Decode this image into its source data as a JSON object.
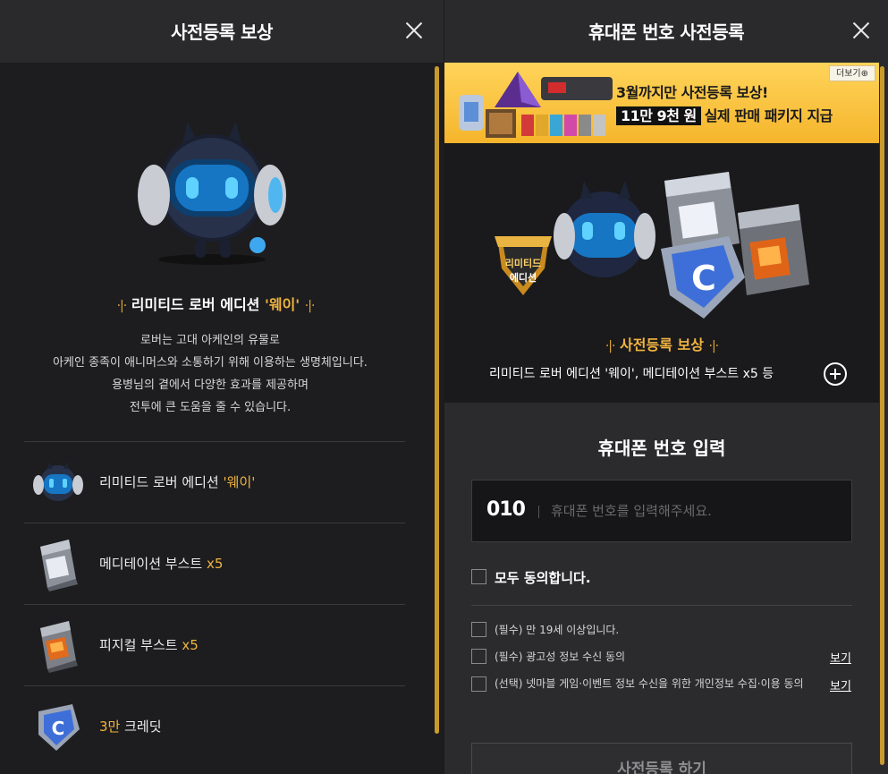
{
  "left_panel": {
    "title": "사전등록 보상",
    "reward_prefix": "리미티드 로버 에디션 ",
    "reward_highlight": "'웨이'",
    "deco": "·|·",
    "description": [
      "로버는 고대 아케인의 유물로",
      "아케인 종족이 애니머스와 소통하기 위해 이용하는 생명체입니다.",
      "용병님의 곁에서 다양한 효과를 제공하며",
      "전투에 큰 도움을 줄 수 있습니다."
    ],
    "items": [
      {
        "label": "리미티드 로버 에디션 ",
        "highlight": "'웨이'",
        "icon": "rover-icon"
      },
      {
        "label": "메디테이션 부스트 ",
        "highlight": "x5",
        "icon": "silver-box-icon"
      },
      {
        "label": "피지컬 부스트 ",
        "highlight": "x5",
        "icon": "orange-box-icon"
      },
      {
        "label": " 크레딧",
        "highlight_first": "3만",
        "icon": "credit-badge-icon"
      }
    ]
  },
  "right_panel": {
    "title": "휴대폰 번호 사전등록",
    "banner": {
      "more": "더보기⊕",
      "line1": "3월까지만 사전등록 보상!",
      "line2_highlight": "11만 9천 원",
      "line2_rest": "실제 판매 패키지 지급"
    },
    "hero": {
      "badge_line1": "리미티드",
      "badge_line2": "에디션",
      "caption_title": "사전등록 보상",
      "caption_detail": "리미티드 로버 에디션 '웨이', 메디테이션 부스트 x5 등"
    },
    "form": {
      "title": "휴대폰 번호 입력",
      "prefix": "010",
      "placeholder": "휴대폰 번호를 입력해주세요.",
      "agree_all": "모두 동의합니다.",
      "terms": [
        {
          "text": "(필수) 만 19세 이상입니다.",
          "view": ""
        },
        {
          "text": "(필수) 광고성 정보 수신 동의",
          "view": "보기"
        },
        {
          "text": "(선택) 넷마블 게임·이벤트 정보 수신을 위한 개인정보 수집·이용 동의",
          "view": "보기"
        }
      ],
      "submit": "사전등록 하기"
    }
  },
  "colors": {
    "accent": "#f1b440",
    "scrollbar": "#c99a2e",
    "banner": "#f5b52c"
  }
}
